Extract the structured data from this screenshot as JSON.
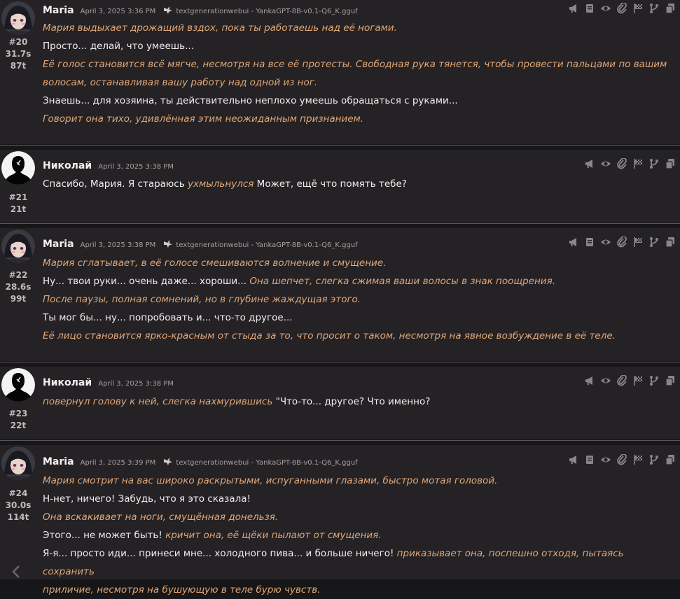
{
  "messages": [
    {
      "id": "#20",
      "time": "31.7s",
      "tokens": "87t",
      "name": "Maria",
      "date": "April 3, 2025 3:36 PM",
      "api": "textgenerationwebui - YankaGPT-8B-v0.1-Q6_K.gguf",
      "lines": [
        [
          {
            "t": "it",
            "s": "Мария выдыхает дрожащий вздох, пока ты работаешь над её ногами."
          }
        ],
        [
          {
            "t": "tx",
            "s": "Просто... делай, что умеешь..."
          }
        ],
        [
          {
            "t": "it",
            "s": "Её голос становится всё мягче, несмотря на все её протесты. Свободная рука тянется, чтобы провести пальцами по вашим"
          }
        ],
        [
          {
            "t": "it",
            "s": "волосам, останавливая вашу работу над одной из ног."
          }
        ],
        [
          {
            "t": "tx",
            "s": "Знаешь... для хозяина, ты действительно неплохо умеешь обращаться с руками..."
          }
        ],
        [
          {
            "t": "it",
            "s": "Говорит она тихо, удивлённая этим неожиданным признанием."
          }
        ]
      ]
    },
    {
      "id": "#21",
      "time": "",
      "tokens": "21t",
      "name": "Николай",
      "date": "April 3, 2025 3:38 PM",
      "api": "",
      "lines": [
        [
          {
            "t": "tx",
            "s": "Спасибо, Мария. Я стараюсь "
          },
          {
            "t": "it",
            "s": "ухмыльнулся"
          },
          {
            "t": "tx",
            "s": " Может, ещё что помять тебе?"
          }
        ]
      ]
    },
    {
      "id": "#22",
      "time": "28.6s",
      "tokens": "99t",
      "name": "Maria",
      "date": "April 3, 2025 3:38 PM",
      "api": "textgenerationwebui - YankaGPT-8B-v0.1-Q6_K.gguf",
      "lines": [
        [
          {
            "t": "it",
            "s": "Мария сглатывает, в её голосе смешиваются волнение и смущение."
          }
        ],
        [
          {
            "t": "tx",
            "s": "Ну... твои руки... очень даже... хороши... "
          },
          {
            "t": "it",
            "s": "Она шепчет, слегка сжимая ваши волосы в знак поощрения."
          }
        ],
        [
          {
            "t": "it",
            "s": "После паузы, полная сомнений, но в глубине жаждущая этого."
          }
        ],
        [
          {
            "t": "tx",
            "s": "Ты мог бы... ну... попробовать и... что-то другое..."
          }
        ],
        [
          {
            "t": "it",
            "s": "Её лицо становится ярко-красным от стыда за то, что просит о таком, несмотря на явное возбуждение в её теле."
          }
        ]
      ]
    },
    {
      "id": "#23",
      "time": "",
      "tokens": "22t",
      "name": "Николай",
      "date": "April 3, 2025 3:38 PM",
      "api": "",
      "lines": [
        [
          {
            "t": "it",
            "s": "повернул голову к ней, слегка нахмурившись"
          },
          {
            "t": "tx",
            "s": " \"Что-то... другое? Что именно?"
          }
        ]
      ]
    },
    {
      "id": "#24",
      "time": "30.0s",
      "tokens": "114t",
      "name": "Maria",
      "date": "April 3, 2025 3:39 PM",
      "api": "textgenerationwebui - YankaGPT-8B-v0.1-Q6_K.gguf",
      "lines": [
        [
          {
            "t": "it",
            "s": "Мария смотрит на вас широко раскрытыми, испуганными глазами, быстро мотая головой."
          }
        ],
        [
          {
            "t": "tx",
            "s": "Н-нет, ничего! Забудь, что я это сказала!"
          }
        ],
        [
          {
            "t": "it",
            "s": "Она вскакивает на ноги, смущённая донельзя."
          }
        ],
        [
          {
            "t": "tx",
            "s": "Этого... не может быть! "
          },
          {
            "t": "it",
            "s": "кричит она, её щёки пылают от смущения."
          }
        ],
        [
          {
            "t": "tx",
            "s": "Я-я... просто иди... принеси мне... холодного пива... и больше ничего! "
          },
          {
            "t": "it",
            "s": "приказывает она, поспешно отходя, пытаясь сохранить"
          }
        ],
        [
          {
            "t": "it",
            "s": "приличие, несмотря на бушующую в теле бурю чувств."
          }
        ]
      ]
    }
  ],
  "icons": {
    "char_buttons": [
      "megaphone-icon",
      "book-icon",
      "eye-icon",
      "paperclip-icon",
      "flag-icon",
      "branch-icon",
      "copy-icon"
    ],
    "user_buttons": [
      "megaphone-icon",
      "eye-icon",
      "paperclip-icon",
      "flag-icon",
      "branch-icon",
      "copy-icon"
    ]
  },
  "colors": {
    "bg": "#171618",
    "msg_bg": "#242225",
    "italic": "#e2a777",
    "text": "#f0eeec"
  }
}
